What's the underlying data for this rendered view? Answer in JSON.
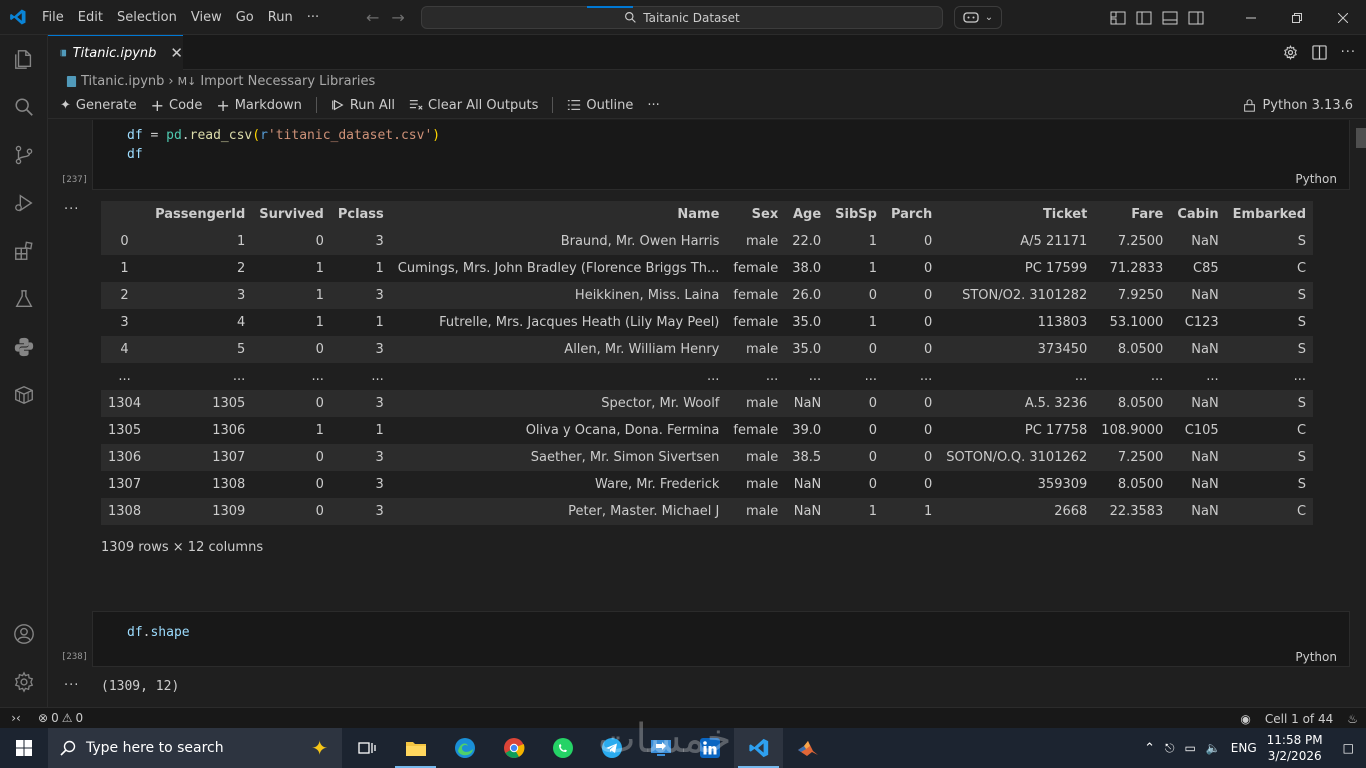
{
  "titlebar": {
    "menu": [
      "File",
      "Edit",
      "Selection",
      "View",
      "Go",
      "Run",
      "···"
    ],
    "search_text": "Taitanic Dataset"
  },
  "tab": {
    "label": "Titanic.ipynb"
  },
  "breadcrumb": {
    "file": "Titanic.ipynb",
    "section": "Import Necessary Libraries"
  },
  "toolbar": {
    "generate": "Generate",
    "code": "Code",
    "markdown": "Markdown",
    "run_all": "Run All",
    "clear_outputs": "Clear All Outputs",
    "outline": "Outline",
    "more": "···",
    "kernel": "Python 3.13.6"
  },
  "cell1": {
    "exec_count": "[237]",
    "lang": "Python",
    "line1": {
      "var": "df",
      "op": " = ",
      "mod": "pd",
      "dot": ".",
      "fn": "read_csv",
      "open": "(",
      "prefix": "r",
      "str": "'titanic_dataset.csv'",
      "close": ")"
    },
    "line2": "df"
  },
  "output1": {
    "more": "···",
    "columns": [
      "",
      "PassengerId",
      "Survived",
      "Pclass",
      "Name",
      "Sex",
      "Age",
      "SibSp",
      "Parch",
      "Ticket",
      "Fare",
      "Cabin",
      "Embarked"
    ],
    "rows": [
      [
        "0",
        "1",
        "0",
        "3",
        "Braund, Mr. Owen Harris",
        "male",
        "22.0",
        "1",
        "0",
        "A/5 21171",
        "7.2500",
        "NaN",
        "S"
      ],
      [
        "1",
        "2",
        "1",
        "1",
        "Cumings, Mrs. John Bradley (Florence Briggs Th...",
        "female",
        "38.0",
        "1",
        "0",
        "PC 17599",
        "71.2833",
        "C85",
        "C"
      ],
      [
        "2",
        "3",
        "1",
        "3",
        "Heikkinen, Miss. Laina",
        "female",
        "26.0",
        "0",
        "0",
        "STON/O2. 3101282",
        "7.9250",
        "NaN",
        "S"
      ],
      [
        "3",
        "4",
        "1",
        "1",
        "Futrelle, Mrs. Jacques Heath (Lily May Peel)",
        "female",
        "35.0",
        "1",
        "0",
        "113803",
        "53.1000",
        "C123",
        "S"
      ],
      [
        "4",
        "5",
        "0",
        "3",
        "Allen, Mr. William Henry",
        "male",
        "35.0",
        "0",
        "0",
        "373450",
        "8.0500",
        "NaN",
        "S"
      ],
      [
        "...",
        "...",
        "...",
        "...",
        "...",
        "...",
        "...",
        "...",
        "...",
        "...",
        "...",
        "...",
        "..."
      ],
      [
        "1304",
        "1305",
        "0",
        "3",
        "Spector, Mr. Woolf",
        "male",
        "NaN",
        "0",
        "0",
        "A.5. 3236",
        "8.0500",
        "NaN",
        "S"
      ],
      [
        "1305",
        "1306",
        "1",
        "1",
        "Oliva y Ocana, Dona. Fermina",
        "female",
        "39.0",
        "0",
        "0",
        "PC 17758",
        "108.9000",
        "C105",
        "C"
      ],
      [
        "1306",
        "1307",
        "0",
        "3",
        "Saether, Mr. Simon Sivertsen",
        "male",
        "38.5",
        "0",
        "0",
        "SOTON/O.Q. 3101262",
        "7.2500",
        "NaN",
        "S"
      ],
      [
        "1307",
        "1308",
        "0",
        "3",
        "Ware, Mr. Frederick",
        "male",
        "NaN",
        "0",
        "0",
        "359309",
        "8.0500",
        "NaN",
        "S"
      ],
      [
        "1308",
        "1309",
        "0",
        "3",
        "Peter, Master. Michael J",
        "male",
        "NaN",
        "1",
        "1",
        "2668",
        "22.3583",
        "NaN",
        "C"
      ]
    ],
    "caption": "1309 rows × 12 columns"
  },
  "cell2": {
    "exec_count": "[238]",
    "lang": "Python",
    "line1": {
      "var": "df",
      "dot": ".",
      "attr": "shape"
    }
  },
  "output2": {
    "more": "···",
    "text": "(1309, 12)"
  },
  "statusbar": {
    "errors": "0",
    "warnings": "0",
    "cell_position": "Cell 1 of 44"
  },
  "taskbar": {
    "search_placeholder": "Type here to search",
    "lang": "ENG",
    "time": "11:58 PM",
    "date": "3/2/2026"
  },
  "colors": {
    "accent": "#0078d4",
    "keyword_var": "#9cdcfe",
    "function": "#dcdcaa",
    "string": "#ce9178",
    "module": "#4ec9b0",
    "prefix": "#569cd6"
  }
}
